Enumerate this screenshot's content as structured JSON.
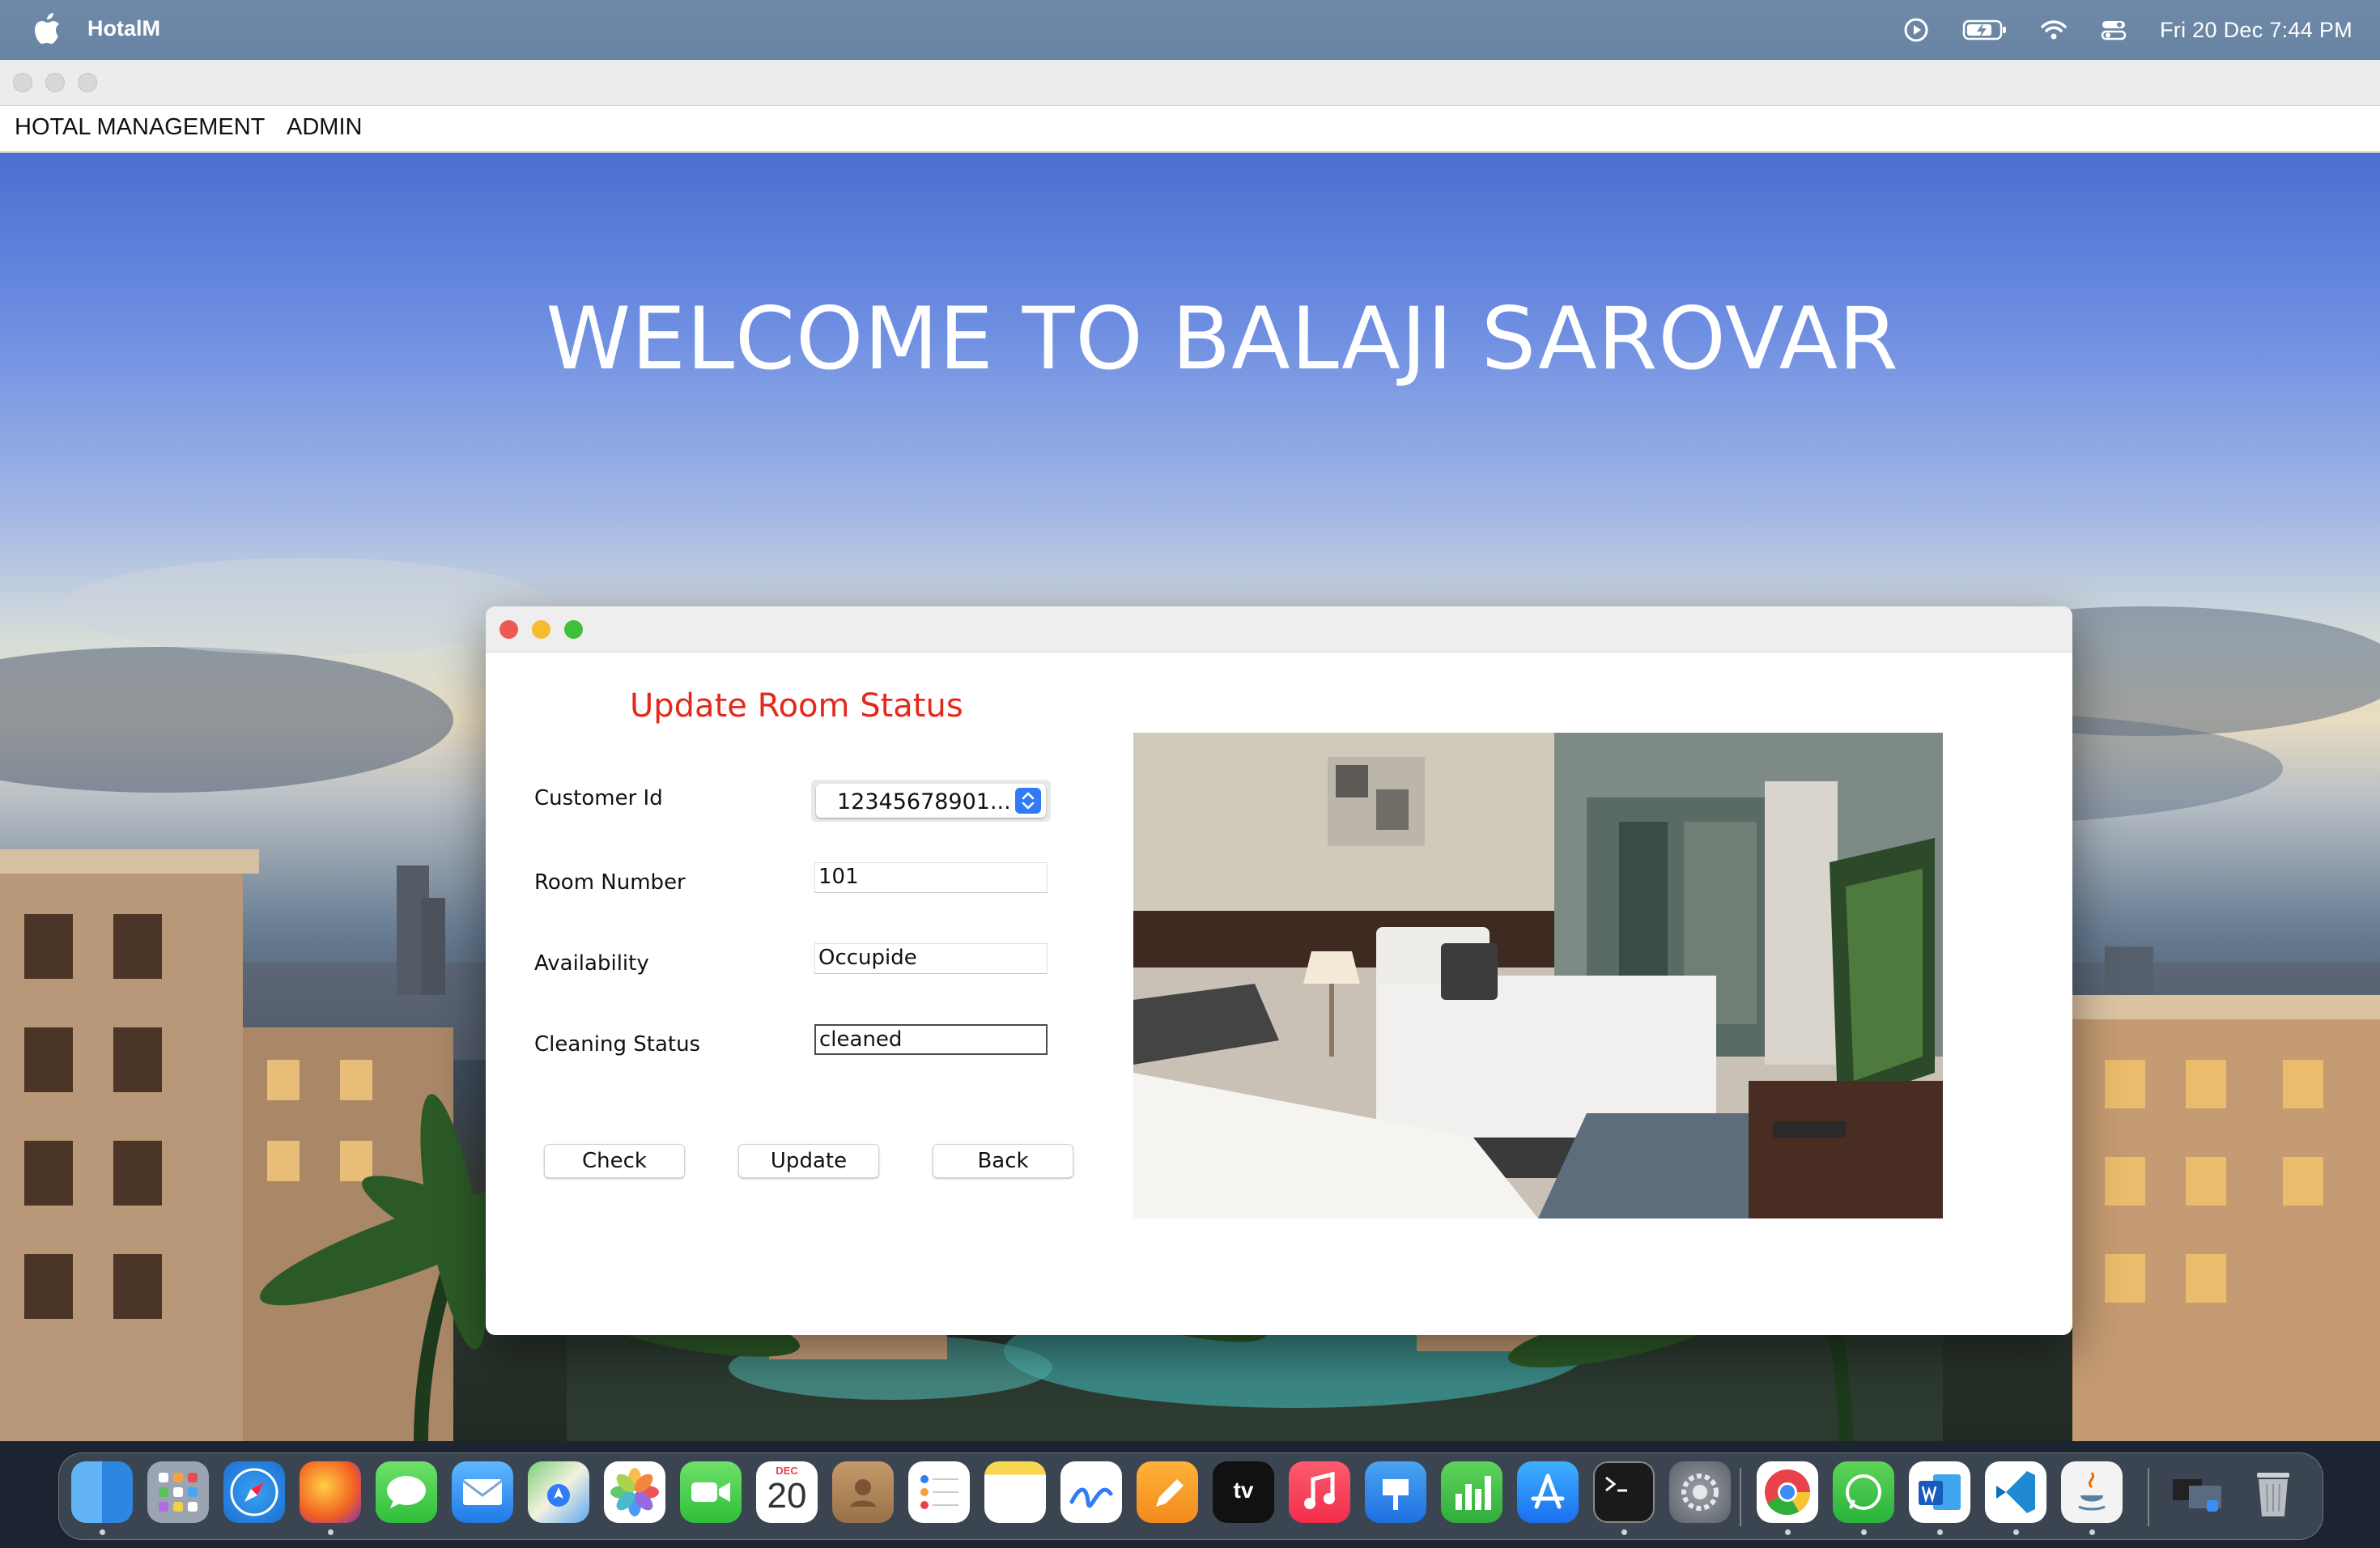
{
  "system_menubar": {
    "app_name": "HotalM",
    "clock": "Fri 20 Dec  7:44 PM",
    "icons": [
      "apple-icon",
      "screen-record-icon",
      "battery-icon",
      "wifi-icon",
      "control-center-icon"
    ]
  },
  "app_menu": {
    "items": [
      "HOTAL MANAGEMENT",
      "ADMIN"
    ]
  },
  "welcome_text": "WELCOME TO BALAJI SAROVAR",
  "dialog": {
    "heading": "Update Room Status",
    "fields": {
      "customer_id": {
        "label": "Customer Id",
        "value": "12345678901..."
      },
      "room_number": {
        "label": "Room Number",
        "value": "101"
      },
      "availability": {
        "label": "Availability",
        "value": "Occupide"
      },
      "cleaning_status": {
        "label": "Cleaning Status",
        "value": "cleaned"
      }
    },
    "buttons": {
      "check": "Check",
      "update": "Update",
      "back": "Back"
    }
  },
  "dock": {
    "calendar": {
      "month": "DEC",
      "day": "20"
    },
    "tv_label": "tv",
    "apps": [
      "finder-icon",
      "launchpad-icon",
      "safari-icon",
      "firefox-icon",
      "messages-icon",
      "mail-icon",
      "maps-icon",
      "photos-icon",
      "facetime-icon",
      "calendar-icon",
      "contacts-icon",
      "reminders-icon",
      "notes-icon",
      "freeform-icon",
      "pages-icon",
      "apple-tv-icon",
      "music-icon",
      "keynote-icon",
      "numbers-icon",
      "app-store-icon",
      "terminal-icon",
      "system-settings-icon",
      "chrome-icon",
      "whatsapp-icon",
      "word-icon",
      "vscode-icon",
      "java-icon",
      "downloads-stack-icon",
      "trash-icon"
    ]
  }
}
